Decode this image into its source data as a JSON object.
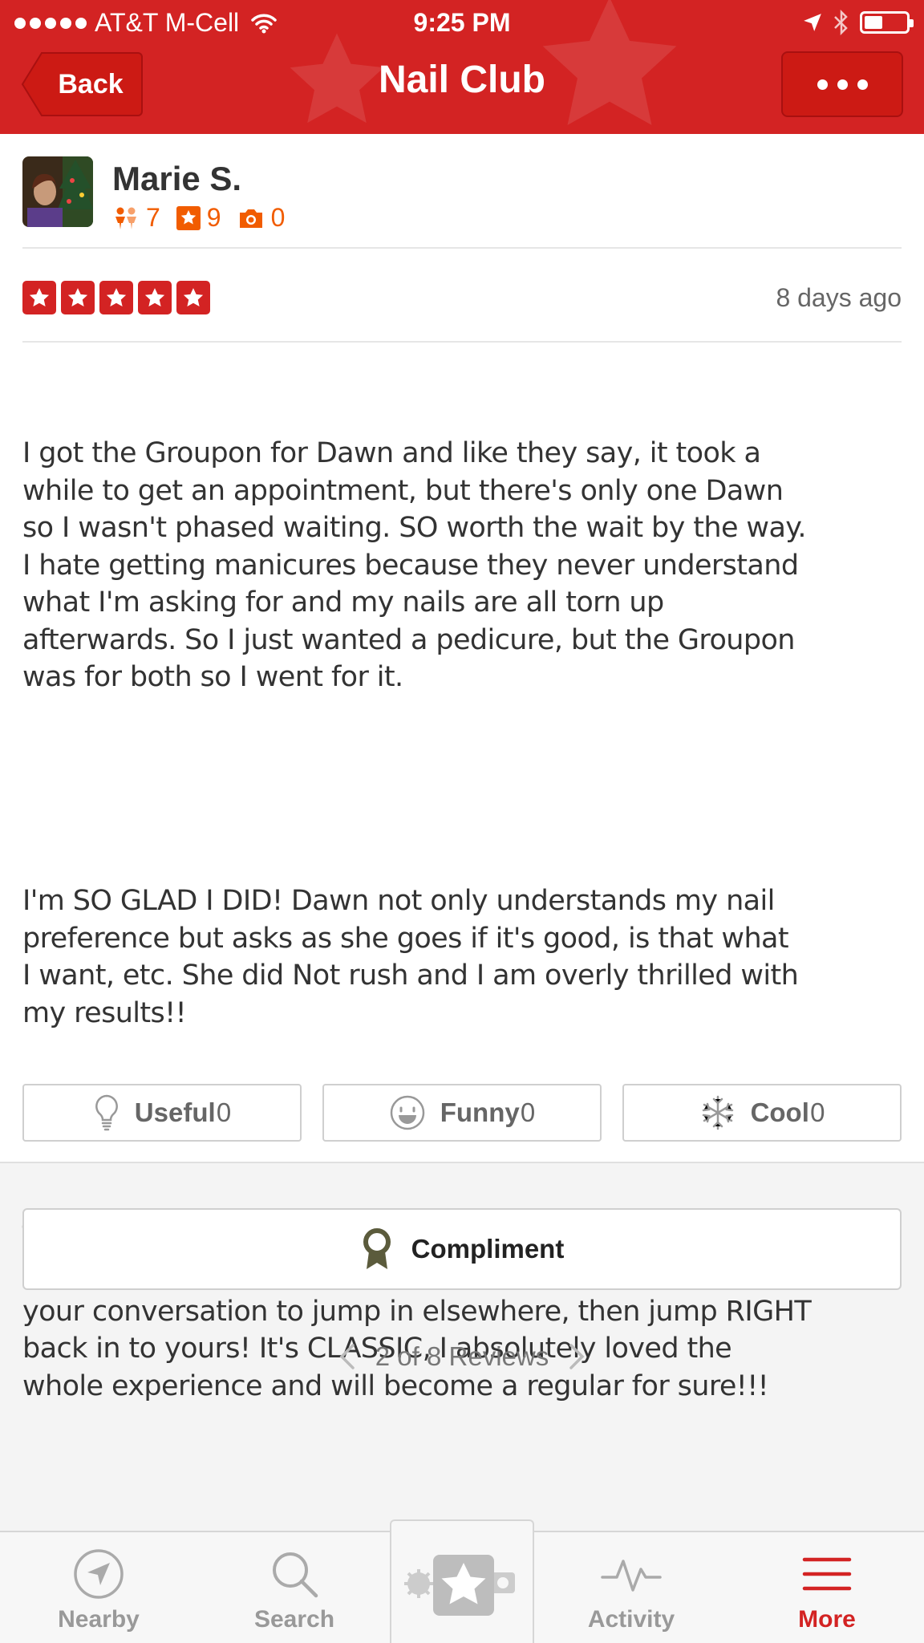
{
  "status_bar": {
    "carrier": "AT&T M-Cell",
    "time": "9:25 PM"
  },
  "nav": {
    "back_label": "Back",
    "title": "Nail Club"
  },
  "review": {
    "user_name": "Marie S.",
    "friends_count": "7",
    "reviews_count": "9",
    "photos_count": "0",
    "rating": 5,
    "date": "8 days ago",
    "paragraphs": [
      "I got the Groupon for Dawn and like they say, it took a\nwhile to get an appointment, but there's only one Dawn\nso I wasn't phased waiting. SO worth the wait by the way.\nI hate getting manicures because they never understand\nwhat I'm asking for and my nails are all torn up\nafterwards. So I just wanted a pedicure, but the Groupon\nwas for both so I went for it.",
      "I'm SO GLAD I DID! Dawn not only understands my nail\npreference but asks as she goes if it's good, is that what\nI want, etc. She did Not rush and I am overly thrilled with\nmy results!!",
      "The Nail Club is sort of like what you see on TV of the\nclassic beauty shop. The gals gossip and chat, interrupt\nyour conversation to jump in elsewhere, then jump RIGHT\nback in to yours! It's CLASSIC, I absolutely loved the\nwhole experience and will become a regular for sure!!!"
    ]
  },
  "votes": {
    "useful_label": "Useful",
    "useful_count": "0",
    "funny_label": "Funny",
    "funny_count": "0",
    "cool_label": "Cool",
    "cool_count": "0"
  },
  "compliment_label": "Compliment",
  "pager_label": "2 of 8 Reviews",
  "tabs": {
    "nearby": "Nearby",
    "search": "Search",
    "activity": "Activity",
    "more": "More"
  },
  "colors": {
    "brand_red": "#d32323",
    "stat_orange": "#f15c00"
  },
  "icons": [
    "location-arrow-icon",
    "bluetooth-icon",
    "battery-icon",
    "wifi-icon",
    "friends-icon",
    "star-icon",
    "camera-icon",
    "lightbulb-icon",
    "smiley-icon",
    "snowflake-icon",
    "ribbon-icon",
    "chevron-left-icon",
    "chevron-right-icon",
    "compass-icon",
    "search-icon",
    "star-camera-icon",
    "activity-icon",
    "menu-icon"
  ]
}
